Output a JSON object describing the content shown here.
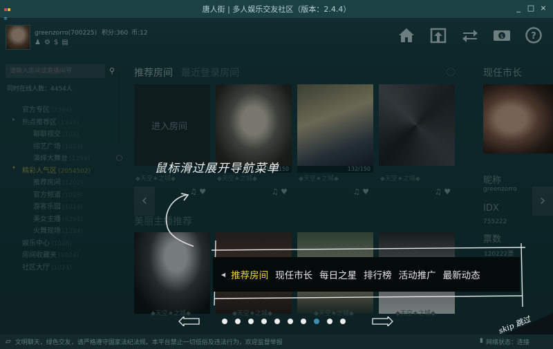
{
  "window": {
    "title": "唐人街 | 多人娱乐交友社区（版本：2.4.4）",
    "controls": [
      "_",
      "□",
      "×"
    ]
  },
  "profile": {
    "username": "greenzorro(700225)",
    "points": "积分:360",
    "coins": "币:12",
    "icons": [
      "user-group-icon",
      "gear-icon",
      "dollar-icon",
      "card-icon"
    ]
  },
  "topnav": [
    {
      "name": "home-icon",
      "glyph": "⌂"
    },
    {
      "name": "upload-icon",
      "glyph": "⇧"
    },
    {
      "name": "swap-icon",
      "glyph": "⇄"
    },
    {
      "name": "money-icon",
      "glyph": "$"
    },
    {
      "name": "help-icon",
      "glyph": "?"
    }
  ],
  "sidebar": {
    "search_placeholder": "请输入房间或直播间号",
    "online": "同时在线人数：4454人",
    "tree": [
      {
        "label": "官方专区",
        "count": "(2294)",
        "indent": 0,
        "arrow": "",
        "highlight": false
      },
      {
        "label": "热点推荐区",
        "count": "(1342)",
        "indent": 0,
        "arrow": "▸",
        "highlight": false
      },
      {
        "label": "聊聊视交",
        "count": "(102)",
        "indent": 1,
        "arrow": "",
        "highlight": false
      },
      {
        "label": "综艺广场",
        "count": "(1024)",
        "indent": 1,
        "arrow": "",
        "highlight": false
      },
      {
        "label": "演绎大舞台",
        "count": "(1294)",
        "indent": 1,
        "arrow": "",
        "highlight": false
      },
      {
        "label": "精彩人气区",
        "count": "(2054502)",
        "indent": 0,
        "arrow": "▾",
        "highlight": true
      },
      {
        "label": "推荐房间",
        "count": "(1202)",
        "indent": 1,
        "arrow": "",
        "highlight": false
      },
      {
        "label": "官方频道",
        "count": "(1028)",
        "indent": 1,
        "arrow": "",
        "highlight": false
      },
      {
        "label": "游客乐园",
        "count": "(1024)",
        "indent": 1,
        "arrow": "",
        "highlight": false
      },
      {
        "label": "美女主播",
        "count": "(4291)",
        "indent": 1,
        "arrow": "",
        "highlight": false
      },
      {
        "label": "火舞现场",
        "count": "(1294)",
        "indent": 1,
        "arrow": "",
        "highlight": false
      },
      {
        "label": "娱乐中心",
        "count": "(1028)",
        "indent": 0,
        "arrow": "",
        "highlight": false
      },
      {
        "label": "房间收藏夹",
        "count": "(1024)",
        "indent": 0,
        "arrow": "",
        "highlight": false
      },
      {
        "label": "社区大厅",
        "count": "(1024)",
        "indent": 0,
        "arrow": "",
        "highlight": false
      }
    ]
  },
  "main": {
    "tab_active": "推荐房间",
    "tab_other": "最近登录房间",
    "enter_room": "进入房间",
    "rooms": [
      {
        "cap": "",
        "title": "◆天空★之城◆",
        "acts": "♫ ♥"
      },
      {
        "cap": "132/150",
        "title": "◆天空★之城◆",
        "acts": "♫ ♥"
      },
      {
        "cap": "132/150",
        "title": "◆天空★之城◆",
        "acts": "♫ ♥"
      },
      {
        "cap": "",
        "title": "◆天空★之城◆",
        "acts": "♫ ♥"
      }
    ],
    "section2": "美丽主播推荐",
    "hosts": [
      {
        "title": "◆天空★之城◆"
      },
      {
        "title": "◆天空★之城◆"
      },
      {
        "title": "◆天空★之城◆"
      },
      {
        "title": "◆天空★之城◆"
      }
    ]
  },
  "rightpanel": {
    "title": "现任市长",
    "nickname_label": "昵称",
    "nickname": "greenzorro",
    "idx_label": "IDX",
    "idx": "755222",
    "votes_label": "票数",
    "votes": "120222票"
  },
  "overlay": {
    "hint": "鼠标滑过展开导航菜单",
    "nav": [
      {
        "label": "推荐房间",
        "active": true
      },
      {
        "label": "现任市长",
        "active": false
      },
      {
        "label": "每日之星",
        "active": false
      },
      {
        "label": "排行榜",
        "active": false
      },
      {
        "label": "活动推广",
        "active": false
      },
      {
        "label": "最新动态",
        "active": false
      }
    ],
    "dots_total": 10,
    "dot_active": 7,
    "skip": "skip 跳过"
  },
  "statusbar": {
    "notice": "文明聊天，绿色交友，请严格遵守国家法纪法规。本平台禁止一切低俗及违法行为，欢迎监督举报",
    "network": "网络状态：连接"
  },
  "colors": {
    "accent": "#f2d23c",
    "highlight": "#9ea04a",
    "dot_active": "#3d8fb0"
  }
}
